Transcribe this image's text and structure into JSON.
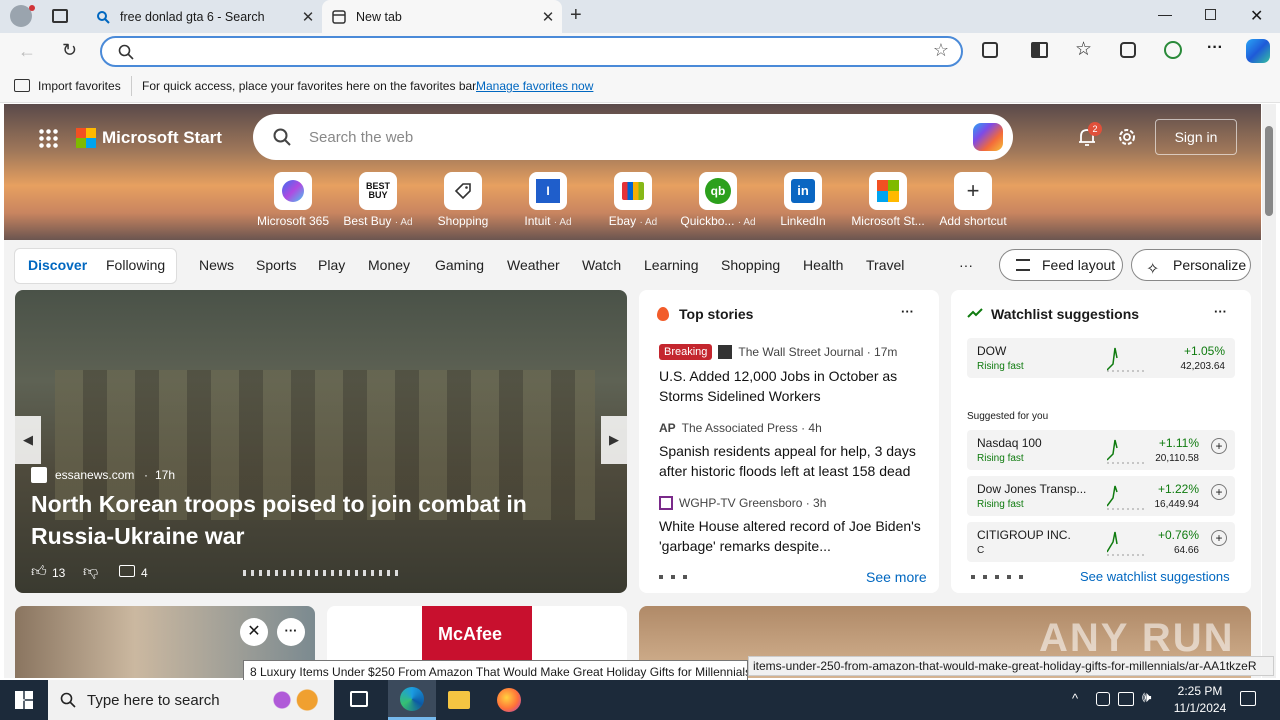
{
  "browser": {
    "tabs": [
      {
        "title": "free donlad gta 6 - Search",
        "active": false
      },
      {
        "title": "New tab",
        "active": true
      }
    ],
    "address_value": "",
    "favorites_bar": {
      "import_label": "Import favorites",
      "hint": "For quick access, place your favorites here on the favorites bar.",
      "manage_link": "Manage favorites now"
    }
  },
  "msstart": {
    "brand": "Microsoft Start",
    "search_placeholder": "Search the web",
    "notification_count": "2",
    "signin_label": "Sign in",
    "quick_links": [
      {
        "label": "Microsoft 365",
        "ad": ""
      },
      {
        "label": "Best Buy",
        "ad": "· Ad"
      },
      {
        "label": "Shopping",
        "ad": ""
      },
      {
        "label": "Intuit",
        "ad": "· Ad"
      },
      {
        "label": "Ebay",
        "ad": "· Ad"
      },
      {
        "label": "Quickbo...",
        "ad": "· Ad"
      },
      {
        "label": "LinkedIn",
        "ad": ""
      },
      {
        "label": "Microsoft St...",
        "ad": ""
      },
      {
        "label": "Add shortcut",
        "ad": ""
      }
    ],
    "nav": {
      "discover": "Discover",
      "following": "Following",
      "items": [
        "News",
        "Sports",
        "Play",
        "Money",
        "Gaming",
        "Weather",
        "Watch",
        "Learning",
        "Shopping",
        "Health",
        "Travel"
      ],
      "more": "···",
      "feed_layout": "Feed layout",
      "personalize": "Personalize"
    },
    "hero": {
      "source": "essanews.com",
      "age": "17h",
      "headline": "North Korean troops poised to join combat in Russia-Ukraine war",
      "likes": "13",
      "comments": "4"
    },
    "top_stories": {
      "title": "Top stories",
      "breaking_label": "Breaking",
      "items": [
        {
          "source": "The Wall Street Journal · 17m",
          "headline": "U.S. Added 12,000 Jobs in October as Storms Sidelined Workers"
        },
        {
          "source": "The Associated Press · 4h",
          "headline": "Spanish residents appeal for help, 3 days after historic floods left at least 158 dead"
        },
        {
          "source": "WGHP-TV Greensboro · 3h",
          "headline": "White House altered record of Joe Biden's 'garbage' remarks despite..."
        }
      ],
      "see_more": "See more"
    },
    "watchlist": {
      "title": "Watchlist suggestions",
      "suggested_label": "Suggested for you",
      "items": [
        {
          "name": "DOW",
          "status": "Rising fast",
          "change": "+1.05%",
          "value": "42,203.64"
        },
        {
          "name": "Nasdaq 100",
          "status": "Rising fast",
          "change": "+1.11%",
          "value": "20,110.58"
        },
        {
          "name": "Dow Jones Transp...",
          "status": "Rising fast",
          "change": "+1.22%",
          "value": "16,449.94"
        },
        {
          "name": "CITIGROUP INC.",
          "status": "C",
          "change": "+0.76%",
          "value": "64.66"
        }
      ],
      "see_link": "See watchlist suggestions"
    },
    "mcafee": "McAfee"
  },
  "tooltip": "8 Luxury Items Under $250 From Amazon That Would Make Great Holiday Gifts for Millennials",
  "status_url": "items-under-250-from-amazon-that-would-make-great-holiday-gifts-for-millennials/ar-AA1tkzeR",
  "watermark": "ANY RUN",
  "taskbar": {
    "search_placeholder": "Type here to search",
    "time": "2:25 PM",
    "date": "11/1/2024"
  },
  "colors": {
    "accent": "#0067c0",
    "positive": "#0f7b0f",
    "breaking": "#c4262e"
  }
}
